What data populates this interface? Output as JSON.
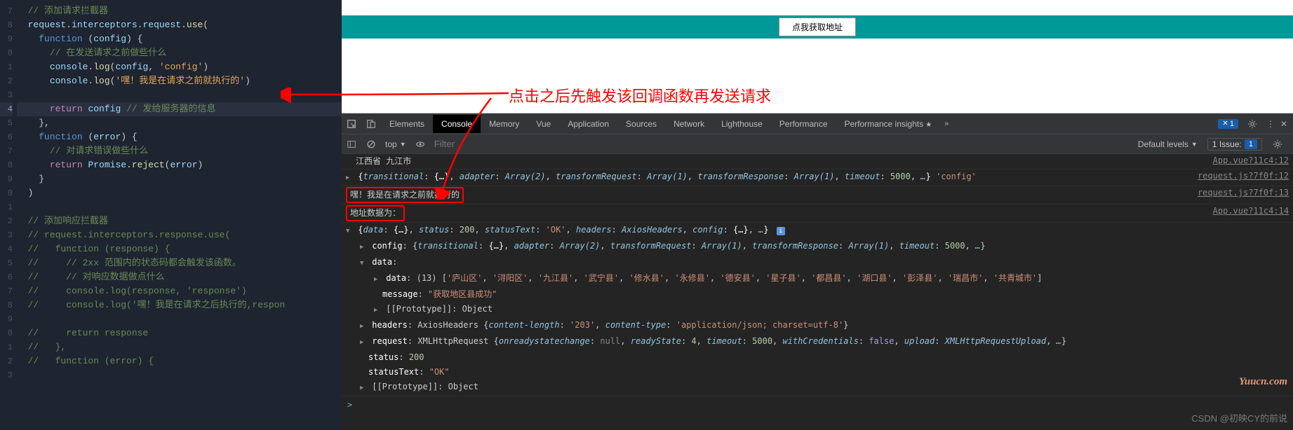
{
  "editor": {
    "lines": [
      7,
      8,
      9,
      0,
      1,
      2,
      3,
      4,
      5,
      6,
      7,
      8,
      9,
      0,
      1,
      2,
      3,
      4,
      5,
      6,
      7,
      8,
      9,
      0,
      1,
      2,
      3
    ],
    "active_line_index": 7,
    "code_html": [
      "  <span class='tok-comment'>// 添加请求拦截器</span>",
      "  <span class='tok-var'>request</span><span class='tok-punc'>.</span><span class='tok-var'>interceptors</span><span class='tok-punc'>.</span><span class='tok-var'>request</span><span class='tok-punc'>.</span><span class='tok-call'>use</span><span class='tok-punc'>(</span>",
      "    <span class='tok-func'>function</span> <span class='tok-punc'>(</span><span class='tok-var'>config</span><span class='tok-punc'>) {</span>",
      "      <span class='tok-comment'>// 在发送请求之前做些什么</span>",
      "      <span class='tok-var'>console</span><span class='tok-punc'>.</span><span class='tok-call'>log</span><span class='tok-punc'>(</span><span class='tok-var'>config</span><span class='tok-punc'>, </span><span class='tok-string'>'config'</span><span class='tok-punc'>)</span>",
      "      <span class='tok-var'>console</span><span class='tok-punc'>.</span><span class='tok-call'>log</span><span class='tok-punc'>(</span><span class='tok-string'>'嘿！我是在请求之前就执行的'</span><span class='tok-punc'>)</span>",
      "",
      "      <span class='tok-keyword'>return</span> <span class='tok-var'>config</span> <span class='tok-comment'>// 发给服务器的信息</span>",
      "    <span class='tok-punc'>},</span>",
      "    <span class='tok-func'>function</span> <span class='tok-punc'>(</span><span class='tok-var'>error</span><span class='tok-punc'>) {</span>",
      "      <span class='tok-comment'>// 对请求错误做些什么</span>",
      "      <span class='tok-keyword'>return</span> <span class='tok-var'>Promise</span><span class='tok-punc'>.</span><span class='tok-call'>reject</span><span class='tok-punc'>(</span><span class='tok-var'>error</span><span class='tok-punc'>)</span>",
      "    <span class='tok-punc'>}</span>",
      "  <span class='tok-punc'>)</span>",
      "",
      "  <span class='tok-comment'>// 添加响应拦截器</span>",
      "  <span class='tok-comment'>// request.interceptors.response.use(</span>",
      "  <span class='tok-comment'>//   function (response) {</span>",
      "  <span class='tok-comment'>//     // 2xx 范围内的状态码都会触发该函数。</span>",
      "  <span class='tok-comment'>//     // 对响应数据做点什么</span>",
      "  <span class='tok-comment'>//     console.log(response, 'response')</span>",
      "  <span class='tok-comment'>//     console.log('嘿！我是在请求之后执行的,respon</span>",
      "",
      "  <span class='tok-comment'>//     return response</span>",
      "  <span class='tok-comment'>//   },</span>",
      "  <span class='tok-comment'>//   function (error) {</span>"
    ]
  },
  "preview": {
    "button_label": "点我获取地址"
  },
  "annotation": "点击之后先触发该回调函数再发送请求",
  "devtools": {
    "tabs": [
      "Elements",
      "Console",
      "Memory",
      "Vue",
      "Application",
      "Sources",
      "Network",
      "Lighthouse",
      "Performance",
      "Performance insights"
    ],
    "active_tab": "Console",
    "error_badge": "1",
    "filter_scope": "top",
    "filter_placeholder": "Filter",
    "levels_label": "Default levels",
    "issue_label": "1 Issue:",
    "issue_count": "1"
  },
  "console": {
    "line1_text": "江西省 九江市",
    "line1_src": "App.vue?11c4:12",
    "line2_html": "<span class='arrow-toggle closed'></span> <span class='obj-brace'>{</span><span class='obj-key'>transitional</span>: <span class='obj-brace'>{…}</span>, <span class='obj-key'>adapter</span>: <span class='obj-key'>Array(2)</span>, <span class='obj-key'>transformRequest</span>: <span class='obj-key'>Array(1)</span>, <span class='obj-key'>transformResponse</span>: <span class='obj-key'>Array(1)</span>, <span class='obj-key'>timeout</span>: <span class='obj-val-num'>5000</span>, <span class='obj-key'>…</span><span class='obj-brace'>}</span> <span class='obj-val-str'>'config'</span>",
    "line2_src": "request.js?7f0f:12",
    "line3_text": "嘿！我是在请求之前就执行的",
    "line3_src": "request.js?7f0f:13",
    "line4_text": "地址数据为：",
    "line4_src": "App.vue?11c4:14",
    "obj_open_html": "<span class='arrow-toggle open'></span> <span class='obj-brace'>{</span><span class='obj-key'>data</span>: <span class='obj-brace'>{…}</span>, <span class='obj-key'>status</span>: <span class='obj-val-num'>200</span>, <span class='obj-key'>statusText</span>: <span class='obj-val-str'>'OK'</span>, <span class='obj-key'>headers</span>: <span class='obj-key'>AxiosHeaders</span>, <span class='obj-key'>config</span>: <span class='obj-brace'>{…}</span>, <span class='obj-key'>…</span><span class='obj-brace'>}</span> <span class='info-icon'>i</span>",
    "config_html": "<span class='arrow-toggle closed'></span> <span class='obj-type'>config</span>: {<span class='obj-key'>transitional</span>: <span class='obj-brace'>{…}</span>, <span class='obj-key'>adapter</span>: <span class='obj-key'>Array(2)</span>, <span class='obj-key'>transformRequest</span>: <span class='obj-key'>Array(1)</span>, <span class='obj-key'>transformResponse</span>: <span class='obj-key'>Array(1)</span>, <span class='obj-key'>timeout</span>: <span class='obj-val-num'>5000</span>, <span class='obj-key'>…</span>}",
    "data_open_html": "<span class='arrow-toggle open'></span> <span class='obj-type'>data</span>:",
    "data_array_html": "<span class='arrow-toggle closed'></span> <span class='obj-type'>data</span>: (13) [<span class='obj-val-str'>'庐山区'</span>, <span class='obj-val-str'>'浔阳区'</span>, <span class='obj-val-str'>'九江县'</span>, <span class='obj-val-str'>'武宁县'</span>, <span class='obj-val-str'>'修水县'</span>, <span class='obj-val-str'>'永修县'</span>, <span class='obj-val-str'>'德安县'</span>, <span class='obj-val-str'>'星子县'</span>, <span class='obj-val-str'>'都昌县'</span>, <span class='obj-val-str'>'湖口县'</span>, <span class='obj-val-str'>'彭泽县'</span>, <span class='obj-val-str'>'瑞昌市'</span>, <span class='obj-val-str'>'共青城市'</span>]",
    "message_html": "<span class='obj-type'>message</span>: <span class='obj-val-str'>\"获取地区县成功\"</span>",
    "proto1_html": "<span class='arrow-toggle closed'></span> [[Prototype]]: Object",
    "headers_html": "<span class='arrow-toggle closed'></span> <span class='obj-type'>headers</span>: AxiosHeaders {<span class='obj-key'>content-length</span>: <span class='obj-val-str'>'203'</span>, <span class='obj-key'>content-type</span>: <span class='obj-val-str'>'application/json; charset=utf-8'</span>}",
    "request_html": "<span class='arrow-toggle closed'></span> <span class='obj-type'>request</span>: XMLHttpRequest {<span class='obj-key'>onreadystatechange</span>: <span class='obj-val-null'>null</span>, <span class='obj-key'>readyState</span>: <span class='obj-val-num'>4</span>, <span class='obj-key'>timeout</span>: <span class='obj-val-num'>5000</span>, <span class='obj-key'>withCredentials</span>: <span class='obj-val-bool'>false</span>, <span class='obj-key'>upload</span>: <span class='obj-key'>XMLHttpRequestUpload</span>, <span class='obj-key'>…</span>}",
    "status_html": "<span class='obj-type'>status</span>: <span class='obj-val-num'>200</span>",
    "statustext_html": "<span class='obj-type'>statusText</span>: <span class='obj-val-str'>\"OK\"</span>",
    "proto2_html": "<span class='arrow-toggle closed'></span> [[Prototype]]: Object",
    "prompt": ">"
  },
  "watermark": "Yuucn.com",
  "csdn": "CSDN @初映CY的前说"
}
